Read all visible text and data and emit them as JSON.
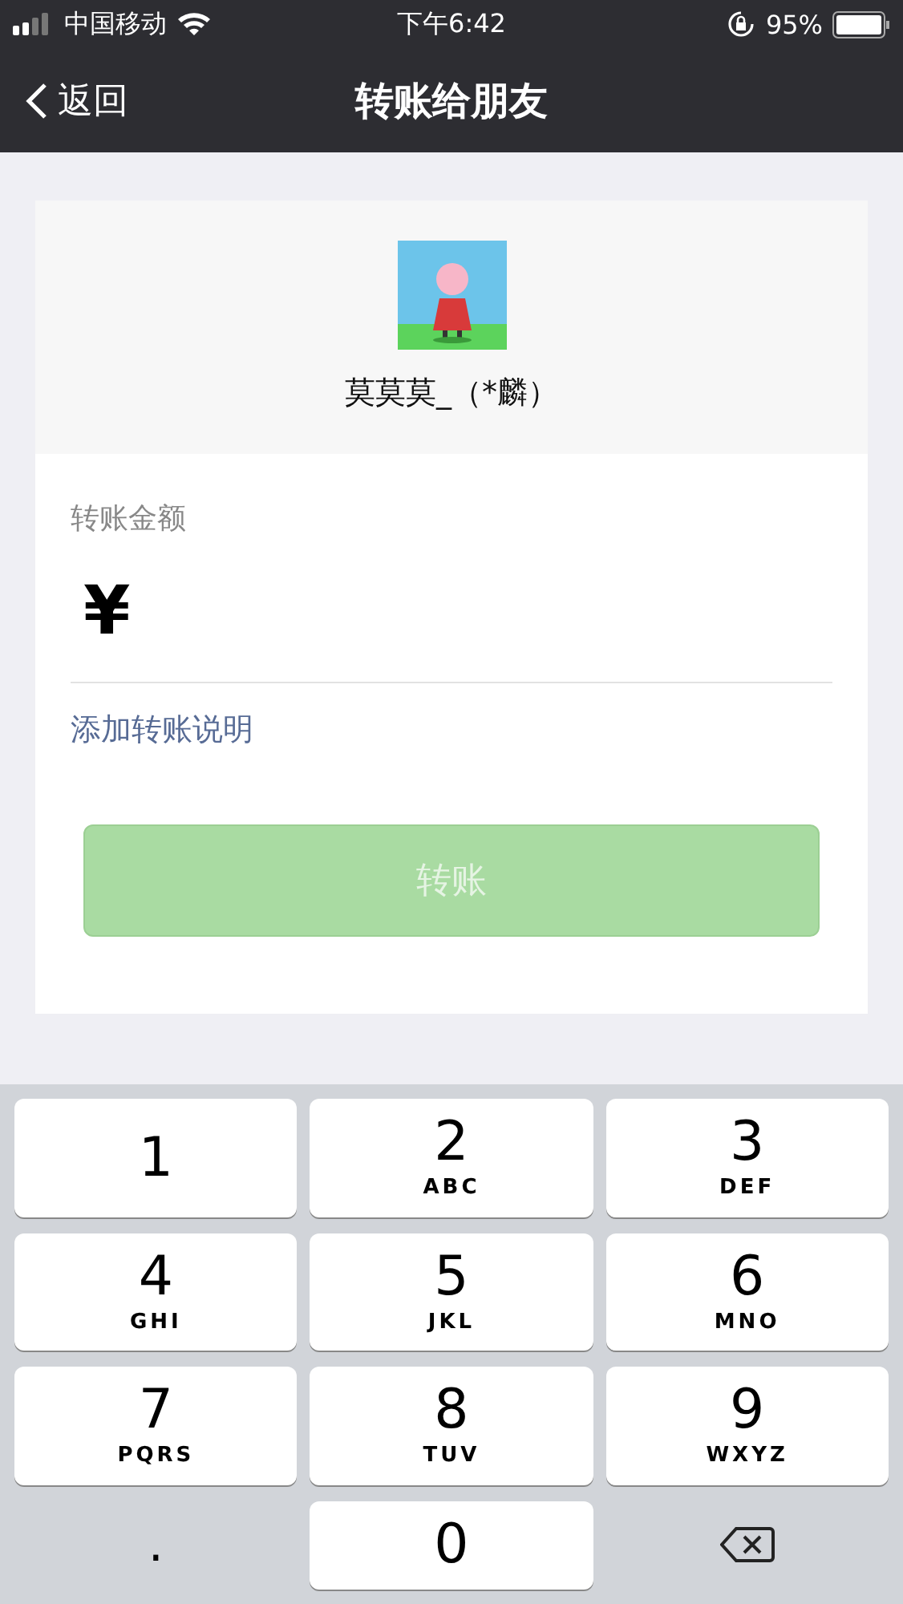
{
  "status_bar": {
    "carrier": "中国移动",
    "time": "下午6:42",
    "battery": "95%"
  },
  "nav": {
    "back": "返回",
    "title": "转账给朋友"
  },
  "recipient": {
    "name": "莫莫莫_（*麟）"
  },
  "amount": {
    "label": "转账金额",
    "currency": "¥"
  },
  "note_link": "添加转账说明",
  "transfer_button": {
    "label": "转账",
    "disabled": true
  },
  "keypad": [
    {
      "kind": "digit",
      "digit": "1"
    },
    {
      "kind": "digit",
      "digit": "2",
      "letters": "ABC"
    },
    {
      "kind": "digit",
      "digit": "3",
      "letters": "DEF"
    },
    {
      "kind": "digit",
      "digit": "4",
      "letters": "GHI"
    },
    {
      "kind": "digit",
      "digit": "5",
      "letters": "JKL"
    },
    {
      "kind": "digit",
      "digit": "6",
      "letters": "MNO"
    },
    {
      "kind": "digit",
      "digit": "7",
      "letters": "PQRS"
    },
    {
      "kind": "digit",
      "digit": "8",
      "letters": "TUV"
    },
    {
      "kind": "digit",
      "digit": "9",
      "letters": "WXYZ"
    },
    {
      "kind": "symbol",
      "digit": "."
    },
    {
      "kind": "digit",
      "digit": "0"
    },
    {
      "kind": "backspace"
    }
  ]
}
